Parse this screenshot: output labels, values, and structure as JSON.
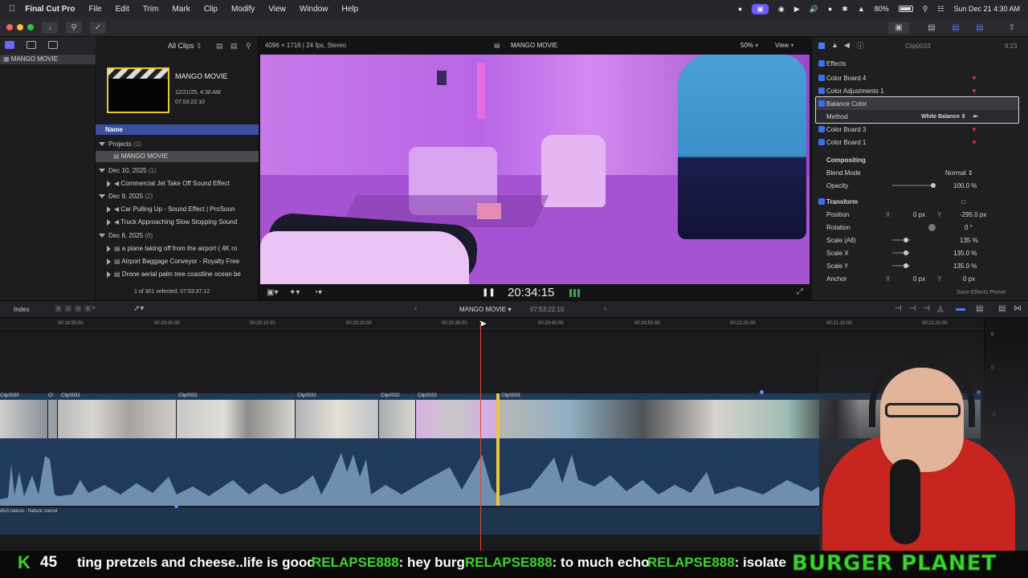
{
  "menubar": {
    "app_name": "Final Cut Pro",
    "items": [
      "File",
      "Edit",
      "Trim",
      "Mark",
      "Clip",
      "Modify",
      "View",
      "Window",
      "Help"
    ],
    "battery": "80%",
    "datetime": "Sun Dec 21  4:30 AM"
  },
  "browser": {
    "filter_label": "All Clips",
    "event_card": {
      "title": "MANGO MOVIE",
      "date": "12/21/25, 4:30 AM",
      "duration": "07:53:22:10"
    },
    "column_header": "Name",
    "groups": [
      {
        "label": "Projects",
        "count": "(1)",
        "items": [
          "MANGO MOVIE"
        ]
      },
      {
        "label": "Dec 10, 2025",
        "count": "(1)",
        "items": [
          "Commercial Jet Take Off Sound Effect"
        ]
      },
      {
        "label": "Dec 9, 2025",
        "count": "(2)",
        "items": [
          "Car Pulling Up - Sound Effect  |  ProSoun",
          "Truck Approaching Slow Stopping Sound"
        ]
      },
      {
        "label": "Dec 8, 2025",
        "count": "(8)",
        "items": [
          "a plane taking off from the airport ( 4K ro",
          "Airport Baggage Conveyor - Royalty Free",
          "Drone aerial palm tree coastline ocean be"
        ]
      }
    ],
    "selection_status": "1 of 301 selected, 07:53:37:12"
  },
  "sidebar": {
    "library_label": "MANGO MOVIE"
  },
  "viewer": {
    "format": "4096 × 1716 | 24 fps, Stereo",
    "title": "MANGO MOVIE",
    "zoom": "50%",
    "view_menu": "View",
    "timecode": "20:34:15"
  },
  "inspector": {
    "clip_name": "Clip0033",
    "clip_duration": "8:23",
    "effects_header": "Effects",
    "effects": [
      "Color Board 4",
      "Color Adjustments 1",
      "Balance Color",
      "Color Board 3",
      "Color Board 1"
    ],
    "method_label": "Method",
    "method_value": "White Balance",
    "compositing_header": "Compositing",
    "blend_mode_label": "Blend Mode",
    "blend_mode_value": "Normal",
    "opacity_label": "Opacity",
    "opacity_value": "100.0 %",
    "transform_header": "Transform",
    "position_label": "Position",
    "position_x": "0 px",
    "position_y": "-295.0 px",
    "x_label": "X",
    "y_label": "Y",
    "rotation_label": "Rotation",
    "rotation_value": "0 °",
    "scale_all_label": "Scale (All)",
    "scale_all_value": "135 %",
    "scale_x_label": "Scale X",
    "scale_x_value": "135.0 %",
    "scale_y_label": "Scale Y",
    "scale_y_value": "135.0 %",
    "anchor_label": "Anchor",
    "anchor_x": "0 px",
    "anchor_y": "0 px",
    "save_preset": "Save Effects Preset"
  },
  "timeline_bar": {
    "index_label": "Index",
    "project_name": "MANGO MOVIE",
    "project_duration": "07:53:22:10"
  },
  "timeline": {
    "ruler": [
      "00:19:50:00",
      "00:20:00:00",
      "00:20:10:00",
      "00:20:20:00",
      "00:20:30:00",
      "00:20:40:00",
      "00:20:50:00",
      "00:21:00:00",
      "00:21:10:00",
      "00:21:20:00"
    ],
    "clips": [
      "Clip0030",
      "Cl",
      "Clip0032",
      "Clip0032",
      "Clip0032",
      "Clip0032",
      "Clip0033",
      "Clip0033"
    ],
    "audio_label": "div3.nature - Nature sound",
    "meter_labels": [
      "6",
      "0",
      "-6"
    ]
  },
  "ticker": {
    "viewer_count": "45",
    "fragment": "ting pretzels and cheese..life is good",
    "messages": [
      {
        "user": "RELAPSE888",
        "text": ": hey burg"
      },
      {
        "user": "RELAPSE888",
        "text": ": to much echo"
      },
      {
        "user": "RELAPSE888",
        "text": ": isolate"
      }
    ],
    "brand": "BURGER PLANET"
  },
  "colors": {
    "accent": "#3c6ff0",
    "playhead": "#e0453a",
    "ticker_green": "#39d62c",
    "audio_fill": "#6f8fb0",
    "track_bg": "#203a5c"
  }
}
